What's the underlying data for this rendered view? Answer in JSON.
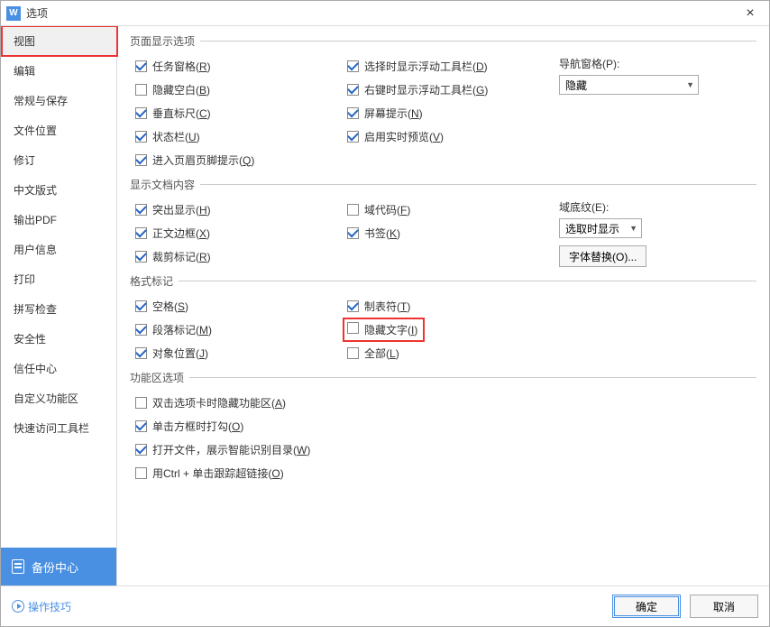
{
  "title": "选项",
  "app_icon_letter": "W",
  "close_label": "×",
  "sidebar": {
    "items": [
      {
        "label": "视图",
        "selected": true,
        "highlight": true
      },
      {
        "label": "编辑"
      },
      {
        "label": "常规与保存"
      },
      {
        "label": "文件位置"
      },
      {
        "label": "修订"
      },
      {
        "label": "中文版式"
      },
      {
        "label": "输出PDF"
      },
      {
        "label": "用户信息"
      },
      {
        "label": "打印"
      },
      {
        "label": "拼写检查"
      },
      {
        "label": "安全性"
      },
      {
        "label": "信任中心"
      },
      {
        "label": "自定义功能区"
      },
      {
        "label": "快速访问工具栏"
      }
    ],
    "backup_label": "备份中心"
  },
  "sections": {
    "page_display": {
      "legend": "页面显示选项",
      "col1": [
        {
          "label": "任务窗格(R)",
          "checked": true
        },
        {
          "label": "隐藏空白(B)",
          "checked": false
        },
        {
          "label": "垂直标尺(C)",
          "checked": true
        },
        {
          "label": "状态栏(U)",
          "checked": true
        },
        {
          "label": "进入页眉页脚提示(Q)",
          "checked": true
        }
      ],
      "col2": [
        {
          "label": "选择时显示浮动工具栏(D)",
          "checked": true
        },
        {
          "label": "右键时显示浮动工具栏(G)",
          "checked": true
        },
        {
          "label": "屏幕提示(N)",
          "checked": true
        },
        {
          "label": "启用实时预览(V)",
          "checked": true
        }
      ],
      "nav_label": "导航窗格(P):",
      "nav_value": "隐藏"
    },
    "doc_content": {
      "legend": "显示文档内容",
      "col1": [
        {
          "label": "突出显示(H)",
          "checked": true
        },
        {
          "label": "正文边框(X)",
          "checked": true
        },
        {
          "label": "裁剪标记(R)",
          "checked": true
        }
      ],
      "col2": [
        {
          "label": "域代码(F)",
          "checked": false
        },
        {
          "label": "书签(K)",
          "checked": true
        }
      ],
      "shading_label": "域底纹(E):",
      "shading_value": "选取时显示",
      "font_replace": "字体替换(O)..."
    },
    "format_marks": {
      "legend": "格式标记",
      "col1": [
        {
          "label": "空格(S)",
          "checked": true
        },
        {
          "label": "段落标记(M)",
          "checked": true
        },
        {
          "label": "对象位置(J)",
          "checked": true
        }
      ],
      "col2": [
        {
          "label": "制表符(T)",
          "checked": true
        },
        {
          "label": "隐藏文字(I)",
          "checked": false,
          "highlight": true
        },
        {
          "label": "全部(L)",
          "checked": false
        }
      ]
    },
    "ribbon": {
      "legend": "功能区选项",
      "items": [
        {
          "label": "双击选项卡时隐藏功能区(A)",
          "checked": false
        },
        {
          "label": "单击方框时打勾(O)",
          "checked": true
        },
        {
          "label": "打开文件，展示智能识别目录(W)",
          "checked": true
        },
        {
          "label": "用Ctrl + 单击跟踪超链接(O)",
          "checked": false
        }
      ]
    }
  },
  "footer": {
    "tips": "操作技巧",
    "ok": "确定",
    "cancel": "取消"
  }
}
